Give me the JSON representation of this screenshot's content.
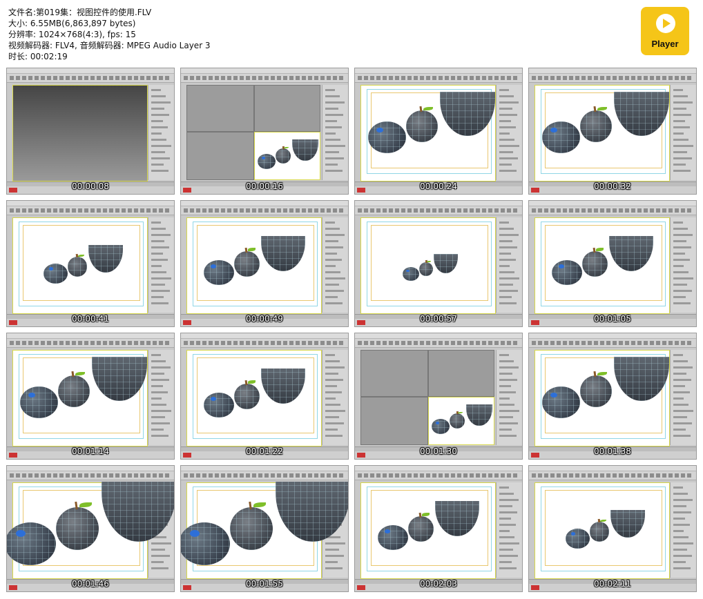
{
  "file_info": {
    "filename": "文件名:第019集：视图控件的使用.FLV",
    "size": "大小: 6.55MB(6,863,897 bytes)",
    "resolution": "分辨率: 1024×768(4:3), fps: 15",
    "codecs": "视频解码器: FLV4, 音频解码器: MPEG Audio Layer 3",
    "duration": "时长: 00:02:19"
  },
  "player_logo": {
    "label": "Player",
    "icon": "play-icon",
    "color": "#f5c518"
  },
  "thumbnails": [
    {
      "time": "00:00:08",
      "view": "dark-empty"
    },
    {
      "time": "00:00:16",
      "view": "quad"
    },
    {
      "time": "00:00:24",
      "view": "fruit-large"
    },
    {
      "time": "00:00:32",
      "view": "fruit-large"
    },
    {
      "time": "00:00:41",
      "view": "fruit-small"
    },
    {
      "time": "00:00:49",
      "view": "fruit-medium"
    },
    {
      "time": "00:00:57",
      "view": "fruit-tiny"
    },
    {
      "time": "00:01:05",
      "view": "fruit-medium"
    },
    {
      "time": "00:01:14",
      "view": "fruit-large"
    },
    {
      "time": "00:01:22",
      "view": "fruit-medium"
    },
    {
      "time": "00:01:30",
      "view": "quad"
    },
    {
      "time": "00:01:38",
      "view": "fruit-large"
    },
    {
      "time": "00:01:46",
      "view": "fruit-zoom"
    },
    {
      "time": "00:01:55",
      "view": "fruit-zoom"
    },
    {
      "time": "00:02:03",
      "view": "fruit-medium"
    },
    {
      "time": "00:02:11",
      "view": "fruit-small"
    }
  ]
}
